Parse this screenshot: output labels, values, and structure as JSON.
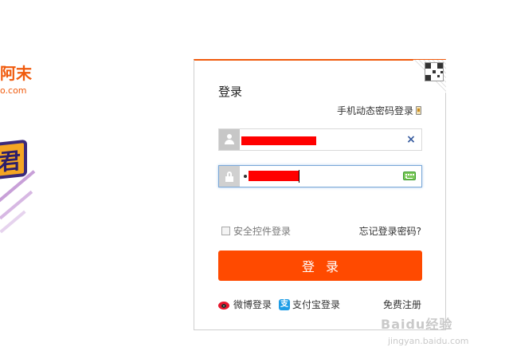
{
  "brand": {
    "name": "阿末",
    "domain": "o.com"
  },
  "promo": {
    "glyph": "君"
  },
  "login": {
    "title": "登录",
    "sms_login_link": "手机动态密码登录",
    "username": {
      "value": "",
      "icon": "user-icon",
      "clear_symbol": "×"
    },
    "password": {
      "value": "",
      "icon": "lock-icon",
      "keyboard_icon": "soft-keyboard-icon"
    },
    "security_control_label": "安全控件登录",
    "security_control_checked": false,
    "forgot_password": "忘记登录密码?",
    "submit_label": "登录",
    "alt_logins": [
      {
        "label": "微博登录",
        "icon": "weibo-icon"
      },
      {
        "label": "支付宝登录",
        "icon": "alipay-icon"
      }
    ],
    "register_link": "免费注册"
  },
  "colors": {
    "accent": "#ff4a00",
    "brand": "#f05a0c",
    "input_focus": "#7aa8d8"
  },
  "watermark": {
    "text": "Baidu经验",
    "sub": "jingyan.baidu.com"
  }
}
